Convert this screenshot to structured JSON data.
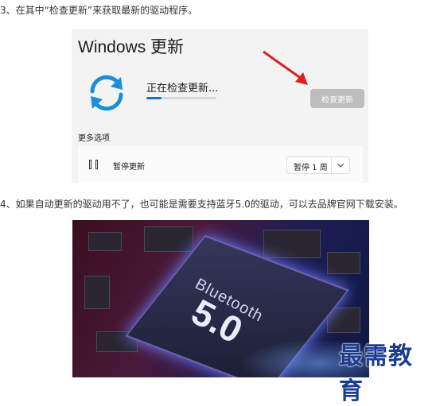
{
  "steps": {
    "step3": "3、在其中“检查更新”来获取最新的驱动程序。",
    "step4": "4、如果自动更新的驱动用不了，也可能是需要支持蓝牙5.0的驱动，可以去品牌官网下载安装。"
  },
  "windows_update": {
    "title": "Windows 更新",
    "status": "正在检查更新...",
    "progress": 0.22,
    "check_button": "检查更新",
    "more_options": "更多选项",
    "pause_label": "暂停更新",
    "pause_duration": "暂停 1 周"
  },
  "bluetooth_image": {
    "label": "Bluetooth",
    "version": "5.0"
  },
  "watermark": "最需教育",
  "colors": {
    "accent": "#1f6ec1",
    "arrow": "#e02020",
    "button_bg": "#bdbdbd"
  }
}
